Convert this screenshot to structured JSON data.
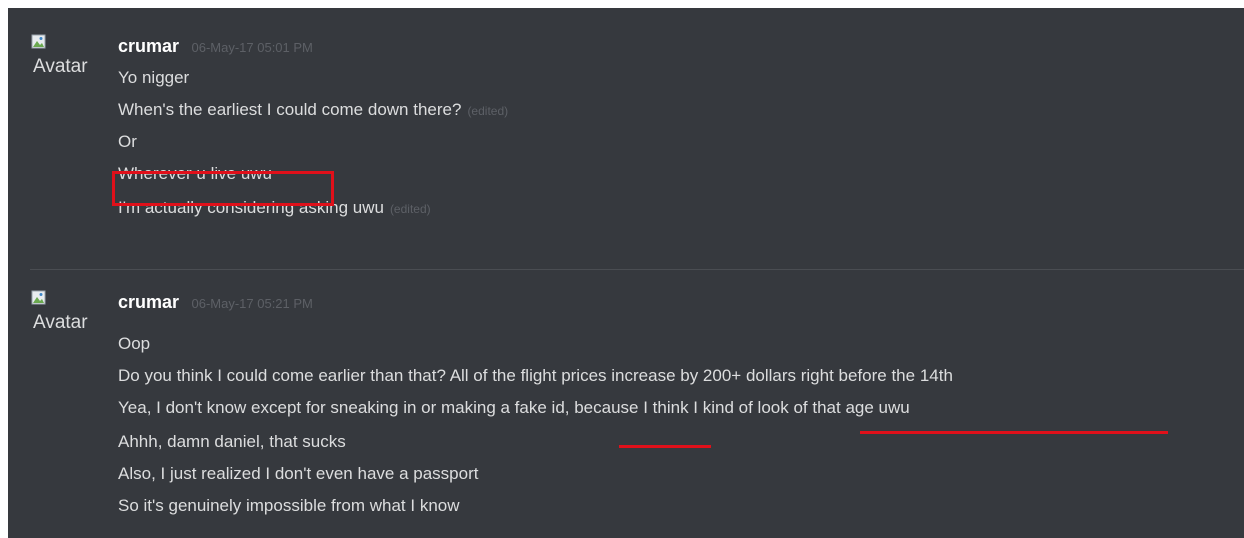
{
  "messages": [
    {
      "avatar_alt": "Avatar",
      "username": "crumar",
      "timestamp": "06-May-17 05:01 PM",
      "lines": [
        {
          "text": "Yo nigger",
          "edited": ""
        },
        {
          "text": "When's the earliest I could come down there?",
          "edited": "(edited)"
        },
        {
          "text": "Or",
          "edited": ""
        },
        {
          "text": "Wherever u live uwu",
          "edited": ""
        },
        {
          "text": "I'm actually considering asking uwu",
          "edited": "(edited)"
        }
      ]
    },
    {
      "avatar_alt": "Avatar",
      "username": "crumar",
      "timestamp": "06-May-17 05:21 PM",
      "lines": [
        {
          "text": "Oop",
          "edited": ""
        },
        {
          "text": "Do you think I could come earlier than that? All of the flight prices increase by 200+ dollars right before the 14th",
          "edited": ""
        },
        {
          "text": "Yea, I don't know except for sneaking in or making a fake id, because I think I kind of look of that age uwu",
          "edited": ""
        },
        {
          "text": "Ahhh, damn daniel, that sucks",
          "edited": ""
        },
        {
          "text": "Also, I just realized I don't even have a passport",
          "edited": ""
        },
        {
          "text": "So it's genuinely impossible from what I know",
          "edited": ""
        }
      ]
    }
  ],
  "highlights": {
    "box_color": "#e0101a",
    "boxed_text": "Wherever u live uwu",
    "underlined": [
      "fake id",
      "I kind of look of that age uwu"
    ]
  },
  "colors": {
    "background": "#36393e",
    "username": "#ffffff",
    "message_text": "#dcddde",
    "meta_text": "#5d6066"
  }
}
